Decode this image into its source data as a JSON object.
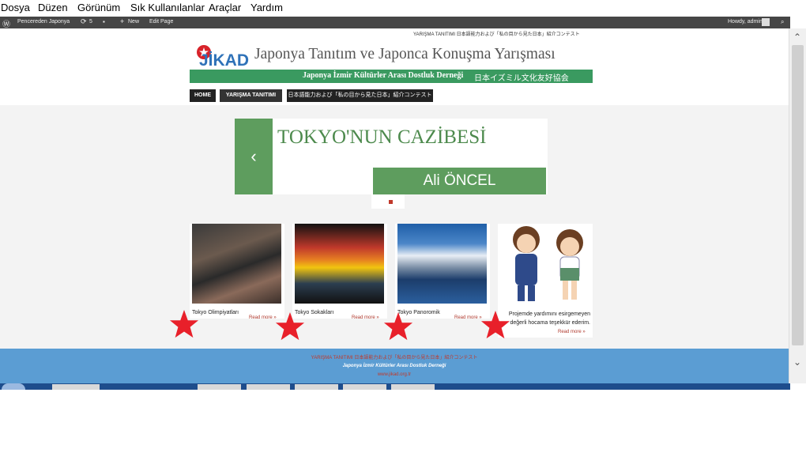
{
  "menu": {
    "items": [
      "Dosya",
      "Düzen",
      "Görünüm",
      "Sık Kullanılanlar",
      "Araçlar",
      "Yardım"
    ]
  },
  "adminbar": {
    "site": "Pencereden Japonya",
    "updates": "5",
    "new": "New",
    "edit": "Edit Page",
    "howdy": "Howdy, admin"
  },
  "header": {
    "toplinks": "YARIŞMA TANITIMI   日本語能力および「私の目から見た日本」紹介コンテスト",
    "logo_text": "JİKAD",
    "title": "Japonya Tanıtım ve Japonca Konuşma Yarışması",
    "association": "Japonya İzmir Kültürler Arası Dostluk Derneği",
    "association_jp": "日本イズミル文化友好協会"
  },
  "nav": {
    "items": [
      "HOME",
      "YARIŞMA TANITIMI",
      "日本語能力および「私の目から見た日本」紹介コンテスト"
    ]
  },
  "slider": {
    "title": "TOKYO'NUN CAZİBESİ",
    "author": "Ali ÖNCEL",
    "prev": "‹"
  },
  "cards": [
    {
      "caption": "Tokyo Olimpiyatları",
      "more": "Read more »"
    },
    {
      "caption": "Tokyo Sokakları",
      "more": "Read more »"
    },
    {
      "caption": "Tokyo Panoromik",
      "more": "Read more »"
    },
    {
      "caption": "Projemde yardımını esirgemeyen değerli hocama teşekkür ederim.",
      "more": "Read more »"
    }
  ],
  "footer": {
    "links": "YARIŞMA TANITIMI   日本語能力および「私の目から見た日本」紹介コンテスト",
    "name": "Japonya İzmir Kültürler Arası Dostluk Derneği",
    "url": "www.jikad.org.tr"
  },
  "colors": {
    "accent": "#3a9a60",
    "footer": "#5b9dd3",
    "star": "#e8202a"
  }
}
